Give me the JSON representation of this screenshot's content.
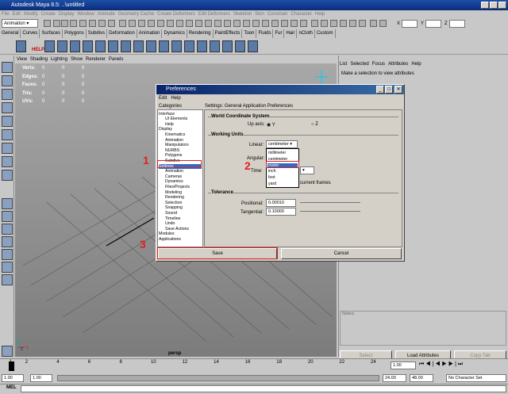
{
  "app": {
    "title": "Autodesk Maya 8.5: ..\\untitled"
  },
  "menubar": {
    "items": [
      "File",
      "Edit",
      "Modify",
      "Create",
      "Display",
      "Window",
      "Animate",
      "Geometry Cache",
      "Create Deformers",
      "Edit Deformers",
      "Skeleton",
      "Skin",
      "Constrain",
      "Character",
      "Help"
    ]
  },
  "statusline": {
    "mode": "Animation",
    "x_label": "X",
    "y_label": "Y",
    "z_label": "Z"
  },
  "shelf": {
    "tabs": [
      "General",
      "Curves",
      "Surfaces",
      "Polygons",
      "Subdivs",
      "Deformation",
      "Animation",
      "Dynamics",
      "Rendering",
      "PaintEffects",
      "Toon",
      "Fluids",
      "Fur",
      "Hair",
      "nCloth",
      "Custom"
    ],
    "help_label": "HELP"
  },
  "viewport": {
    "menu": [
      "View",
      "Shading",
      "Lighting",
      "Show",
      "Renderer",
      "Panels"
    ],
    "hud": [
      {
        "label": "Verts:",
        "v": [
          "0",
          "0",
          "0"
        ]
      },
      {
        "label": "Edges:",
        "v": [
          "0",
          "0",
          "0"
        ]
      },
      {
        "label": "Faces:",
        "v": [
          "0",
          "0",
          "0"
        ]
      },
      {
        "label": "Tris:",
        "v": [
          "0",
          "0",
          "0"
        ]
      },
      {
        "label": "UVs:",
        "v": [
          "0",
          "0",
          "0"
        ]
      }
    ],
    "camera": "persp",
    "axis_y": "y",
    "axis_x": "x",
    "axis_z": "z"
  },
  "attr": {
    "menu": [
      "List",
      "Selected",
      "Focus",
      "Attributes",
      "Help"
    ],
    "hint": "Make a selection to view attributes",
    "notes": "Notes:",
    "select": "Select",
    "load": "Load Attributes",
    "copy": "Copy Tab"
  },
  "dialog": {
    "title": "Preferences",
    "menu": [
      "Edit",
      "Help"
    ],
    "categories_header": "Categories",
    "categories": [
      {
        "t": "Interface",
        "i": 0
      },
      {
        "t": "UI Elements",
        "i": 1
      },
      {
        "t": "Help",
        "i": 1
      },
      {
        "t": "Display",
        "i": 0
      },
      {
        "t": "Kinematics",
        "i": 1
      },
      {
        "t": "Animation",
        "i": 1
      },
      {
        "t": "Manipulators",
        "i": 1
      },
      {
        "t": "NURBS",
        "i": 1
      },
      {
        "t": "Polygons",
        "i": 1
      },
      {
        "t": "Subdivs",
        "i": 1
      },
      {
        "t": "Settings",
        "i": 0
      },
      {
        "t": "Animation",
        "i": 1
      },
      {
        "t": "Cameras",
        "i": 1
      },
      {
        "t": "Dynamics",
        "i": 1
      },
      {
        "t": "Files/Projects",
        "i": 1
      },
      {
        "t": "Modeling",
        "i": 1
      },
      {
        "t": "Rendering",
        "i": 1
      },
      {
        "t": "Selection",
        "i": 1
      },
      {
        "t": "Snapping",
        "i": 1
      },
      {
        "t": "Sound",
        "i": 1
      },
      {
        "t": "Timeline",
        "i": 1
      },
      {
        "t": "Undo",
        "i": 1
      },
      {
        "t": "Save Actions",
        "i": 1
      },
      {
        "t": "Modules",
        "i": 0
      },
      {
        "t": "Applications",
        "i": 0
      }
    ],
    "selected_index": 10,
    "settings_header": "Settings: General Application Preferences",
    "wcs": {
      "title": "World Coordinate System",
      "upaxis": "Up axis:",
      "y": "Y",
      "z": "Z"
    },
    "units": {
      "title": "Working Units",
      "linear": "Linear:",
      "linear_value": "centimeter",
      "angular": "Angular:",
      "time": "Time:",
      "time_suffix": "current frames"
    },
    "dropdown": [
      "millimeter",
      "centimeter",
      "meter",
      "inch",
      "foot",
      "yard"
    ],
    "dropdown_selected": 2,
    "tol": {
      "title": "Tolerance",
      "pos": "Positional:",
      "pos_val": "0.00010",
      "tan": "Tangential:",
      "tan_val": "0.10000"
    },
    "save": "Save",
    "cancel": "Cancel"
  },
  "steps": [
    "1",
    "2",
    "3"
  ],
  "timeline": {
    "ticks": [
      "1",
      "2",
      "4",
      "6",
      "8",
      "10",
      "12",
      "14",
      "16",
      "18",
      "20",
      "22",
      "24"
    ],
    "current": "1.00"
  },
  "range": {
    "start": "1.00",
    "inner_start": "1.00",
    "end": "24.00",
    "total": "48.00",
    "charset": "No Character Set"
  },
  "mel": {
    "label": "MEL"
  },
  "colors": {
    "accent": "#0a246a",
    "highlight": "#316ac5",
    "annot": "#e02020"
  }
}
